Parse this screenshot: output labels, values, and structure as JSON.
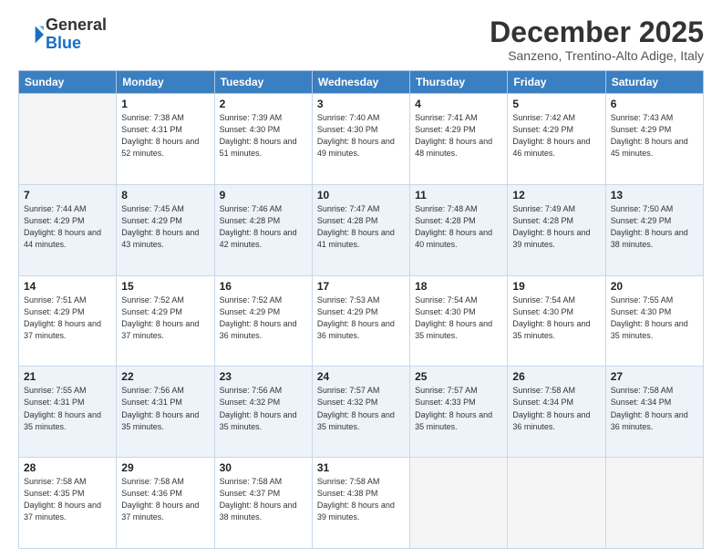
{
  "header": {
    "logo_line1": "General",
    "logo_line2": "Blue",
    "month": "December 2025",
    "location": "Sanzeno, Trentino-Alto Adige, Italy"
  },
  "weekdays": [
    "Sunday",
    "Monday",
    "Tuesday",
    "Wednesday",
    "Thursday",
    "Friday",
    "Saturday"
  ],
  "weeks": [
    [
      {
        "day": "",
        "sunrise": "",
        "sunset": "",
        "daylight": ""
      },
      {
        "day": "1",
        "sunrise": "7:38 AM",
        "sunset": "4:31 PM",
        "daylight": "8 hours and 52 minutes."
      },
      {
        "day": "2",
        "sunrise": "7:39 AM",
        "sunset": "4:30 PM",
        "daylight": "8 hours and 51 minutes."
      },
      {
        "day": "3",
        "sunrise": "7:40 AM",
        "sunset": "4:30 PM",
        "daylight": "8 hours and 49 minutes."
      },
      {
        "day": "4",
        "sunrise": "7:41 AM",
        "sunset": "4:29 PM",
        "daylight": "8 hours and 48 minutes."
      },
      {
        "day": "5",
        "sunrise": "7:42 AM",
        "sunset": "4:29 PM",
        "daylight": "8 hours and 46 minutes."
      },
      {
        "day": "6",
        "sunrise": "7:43 AM",
        "sunset": "4:29 PM",
        "daylight": "8 hours and 45 minutes."
      }
    ],
    [
      {
        "day": "7",
        "sunrise": "7:44 AM",
        "sunset": "4:29 PM",
        "daylight": "8 hours and 44 minutes."
      },
      {
        "day": "8",
        "sunrise": "7:45 AM",
        "sunset": "4:29 PM",
        "daylight": "8 hours and 43 minutes."
      },
      {
        "day": "9",
        "sunrise": "7:46 AM",
        "sunset": "4:28 PM",
        "daylight": "8 hours and 42 minutes."
      },
      {
        "day": "10",
        "sunrise": "7:47 AM",
        "sunset": "4:28 PM",
        "daylight": "8 hours and 41 minutes."
      },
      {
        "day": "11",
        "sunrise": "7:48 AM",
        "sunset": "4:28 PM",
        "daylight": "8 hours and 40 minutes."
      },
      {
        "day": "12",
        "sunrise": "7:49 AM",
        "sunset": "4:28 PM",
        "daylight": "8 hours and 39 minutes."
      },
      {
        "day": "13",
        "sunrise": "7:50 AM",
        "sunset": "4:29 PM",
        "daylight": "8 hours and 38 minutes."
      }
    ],
    [
      {
        "day": "14",
        "sunrise": "7:51 AM",
        "sunset": "4:29 PM",
        "daylight": "8 hours and 37 minutes."
      },
      {
        "day": "15",
        "sunrise": "7:52 AM",
        "sunset": "4:29 PM",
        "daylight": "8 hours and 37 minutes."
      },
      {
        "day": "16",
        "sunrise": "7:52 AM",
        "sunset": "4:29 PM",
        "daylight": "8 hours and 36 minutes."
      },
      {
        "day": "17",
        "sunrise": "7:53 AM",
        "sunset": "4:29 PM",
        "daylight": "8 hours and 36 minutes."
      },
      {
        "day": "18",
        "sunrise": "7:54 AM",
        "sunset": "4:30 PM",
        "daylight": "8 hours and 35 minutes."
      },
      {
        "day": "19",
        "sunrise": "7:54 AM",
        "sunset": "4:30 PM",
        "daylight": "8 hours and 35 minutes."
      },
      {
        "day": "20",
        "sunrise": "7:55 AM",
        "sunset": "4:30 PM",
        "daylight": "8 hours and 35 minutes."
      }
    ],
    [
      {
        "day": "21",
        "sunrise": "7:55 AM",
        "sunset": "4:31 PM",
        "daylight": "8 hours and 35 minutes."
      },
      {
        "day": "22",
        "sunrise": "7:56 AM",
        "sunset": "4:31 PM",
        "daylight": "8 hours and 35 minutes."
      },
      {
        "day": "23",
        "sunrise": "7:56 AM",
        "sunset": "4:32 PM",
        "daylight": "8 hours and 35 minutes."
      },
      {
        "day": "24",
        "sunrise": "7:57 AM",
        "sunset": "4:32 PM",
        "daylight": "8 hours and 35 minutes."
      },
      {
        "day": "25",
        "sunrise": "7:57 AM",
        "sunset": "4:33 PM",
        "daylight": "8 hours and 35 minutes."
      },
      {
        "day": "26",
        "sunrise": "7:58 AM",
        "sunset": "4:34 PM",
        "daylight": "8 hours and 36 minutes."
      },
      {
        "day": "27",
        "sunrise": "7:58 AM",
        "sunset": "4:34 PM",
        "daylight": "8 hours and 36 minutes."
      }
    ],
    [
      {
        "day": "28",
        "sunrise": "7:58 AM",
        "sunset": "4:35 PM",
        "daylight": "8 hours and 37 minutes."
      },
      {
        "day": "29",
        "sunrise": "7:58 AM",
        "sunset": "4:36 PM",
        "daylight": "8 hours and 37 minutes."
      },
      {
        "day": "30",
        "sunrise": "7:58 AM",
        "sunset": "4:37 PM",
        "daylight": "8 hours and 38 minutes."
      },
      {
        "day": "31",
        "sunrise": "7:58 AM",
        "sunset": "4:38 PM",
        "daylight": "8 hours and 39 minutes."
      },
      {
        "day": "",
        "sunrise": "",
        "sunset": "",
        "daylight": ""
      },
      {
        "day": "",
        "sunrise": "",
        "sunset": "",
        "daylight": ""
      },
      {
        "day": "",
        "sunrise": "",
        "sunset": "",
        "daylight": ""
      }
    ]
  ],
  "labels": {
    "sunrise_prefix": "Sunrise: ",
    "sunset_prefix": "Sunset: ",
    "daylight_prefix": "Daylight: "
  }
}
